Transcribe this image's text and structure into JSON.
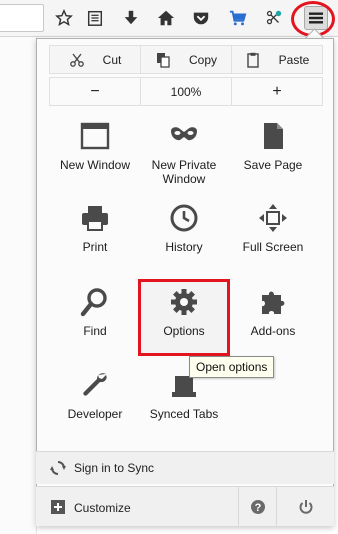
{
  "toolbar": {
    "icons": [
      "bookmark-star-icon",
      "reading-list-icon",
      "download-icon",
      "home-icon",
      "pocket-icon",
      "shopping-cart-icon",
      "extension-icon",
      "hamburger-menu-icon"
    ]
  },
  "menu": {
    "edit_row": {
      "cut": "Cut",
      "copy": "Copy",
      "paste": "Paste"
    },
    "zoom_row": {
      "minus": "−",
      "level": "100%",
      "plus": "+"
    },
    "items": [
      {
        "label": "New Window",
        "icon": "new-window-icon"
      },
      {
        "label": "New Private\nWindow",
        "label_line1": "New Private",
        "label_line2": "Window",
        "icon": "private-mask-icon"
      },
      {
        "label": "Save Page",
        "icon": "save-page-icon"
      },
      {
        "label": "Print",
        "icon": "printer-icon"
      },
      {
        "label": "History",
        "icon": "clock-icon"
      },
      {
        "label": "Full Screen",
        "icon": "fullscreen-icon"
      },
      {
        "label": "Find",
        "icon": "magnifier-icon"
      },
      {
        "label": "Options",
        "icon": "gear-icon"
      },
      {
        "label": "Add-ons",
        "icon": "puzzle-icon"
      },
      {
        "label": "Developer",
        "icon": "wrench-icon"
      },
      {
        "label": "Synced Tabs",
        "icon": "synced-tabs-icon"
      }
    ],
    "tooltip": "Open options",
    "sync_label": "Sign in to Sync",
    "customize_label": "Customize",
    "help_symbol": "?"
  },
  "colors": {
    "highlight_red": "#e3141f",
    "panel_bg": "#fbfbfb",
    "icon_gray": "#4a4a4a",
    "cart_blue": "#2a6ecf"
  }
}
